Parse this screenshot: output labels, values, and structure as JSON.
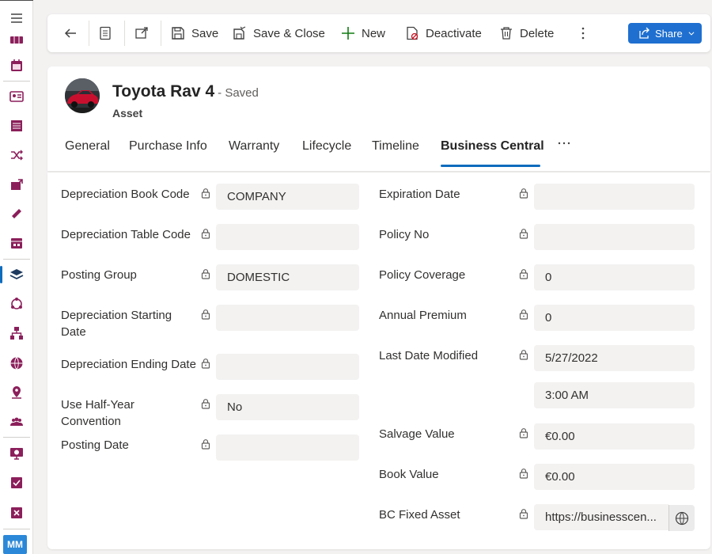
{
  "sidebar": {
    "user_initials": "MM"
  },
  "toolbar": {
    "save": "Save",
    "save_close": "Save & Close",
    "new": "New",
    "deactivate": "Deactivate",
    "delete": "Delete",
    "share": "Share"
  },
  "record": {
    "title": "Toyota Rav 4",
    "status": "- Saved",
    "entity": "Asset"
  },
  "tabs": [
    "General",
    "Purchase Info",
    "Warranty",
    "Lifecycle",
    "Timeline",
    "Business Central"
  ],
  "left_fields": [
    {
      "label": "Depreciation Book Code",
      "value": "COMPANY"
    },
    {
      "label": "Depreciation Table Code",
      "value": ""
    },
    {
      "label": "Posting Group",
      "value": "DOMESTIC"
    },
    {
      "label": "Depreciation Starting Date",
      "value": ""
    },
    {
      "label": "Depreciation Ending Date",
      "value": ""
    },
    {
      "label": "Use Half-Year Convention",
      "value": "No"
    },
    {
      "label": "Posting Date",
      "value": ""
    }
  ],
  "right_fields": [
    {
      "label": "Expiration Date",
      "value": ""
    },
    {
      "label": "Policy No",
      "value": ""
    },
    {
      "label": "Policy Coverage",
      "value": "0"
    },
    {
      "label": "Annual Premium",
      "value": "0"
    },
    {
      "label": "Last Date Modified",
      "value": "5/27/2022",
      "time": "3:00 AM"
    },
    {
      "label": "Salvage Value",
      "value": "€0.00"
    },
    {
      "label": "Book Value",
      "value": "€0.00"
    },
    {
      "label": "BC Fixed Asset",
      "value": "https://businesscen..."
    }
  ]
}
